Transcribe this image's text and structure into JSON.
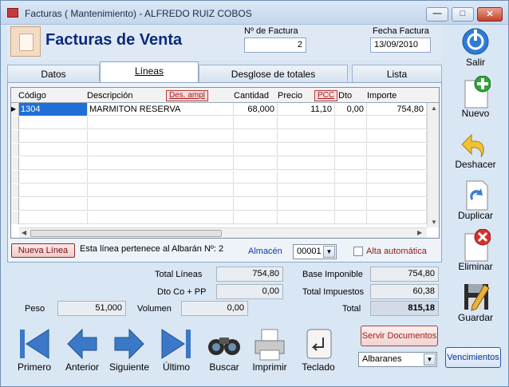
{
  "window": {
    "title": "Facturas ( Mantenimiento) - ALFREDO RUIZ COBOS"
  },
  "header": {
    "title": "Facturas de Venta",
    "invoice_no_label": "Nº de Factura",
    "invoice_no": "2",
    "date_label": "Fecha Factura",
    "date": "13/09/2010"
  },
  "tabs": [
    {
      "label": "Datos"
    },
    {
      "label": "Líneas"
    },
    {
      "label": "Desglose de totales"
    },
    {
      "label": "Lista"
    }
  ],
  "grid": {
    "headers": {
      "codigo": "Código",
      "descripcion": "Descripción",
      "des_ampl": "Des. ampl",
      "cantidad": "Cantidad",
      "precio": "Precio",
      "pcc": "PCC",
      "dto": "Dto",
      "importe": "Importe"
    },
    "rows": [
      {
        "codigo": "1304",
        "descripcion": "MARMITON RESERVA",
        "cantidad": "68,000",
        "precio": "11,10",
        "dto": "0,00",
        "importe": "754,80"
      }
    ]
  },
  "lines": {
    "new_line": "Nueva Línea",
    "albaran_text": "Esta línea pertenece al Albarán Nº: 2",
    "almacen_label": "Almacén",
    "almacen_value": "00001",
    "alta_auto": "Alta automática"
  },
  "totals": {
    "total_lineas_label": "Total Líneas",
    "total_lineas": "754,80",
    "dto_label": "Dto Co + PP",
    "dto": "0,00",
    "peso_label": "Peso",
    "peso": "51,000",
    "volumen_label": "Volumen",
    "volumen": "0,00",
    "base_label": "Base Imponible",
    "base": "754,80",
    "impuestos_label": "Total Impuestos",
    "impuestos": "60,38",
    "total_label": "Total",
    "total": "815,18"
  },
  "side": {
    "salir": "Salir",
    "nuevo": "Nuevo",
    "deshacer": "Deshacer",
    "duplicar": "Duplicar",
    "eliminar": "Eliminar",
    "guardar": "Guardar"
  },
  "bottom": {
    "primero": "Primero",
    "anterior": "Anterior",
    "siguiente": "Siguiente",
    "ultimo": "Último",
    "buscar": "Buscar",
    "imprimir": "Imprimir",
    "teclado": "Teclado"
  },
  "actions": {
    "servir": "Servir Documentos",
    "doc_type": "Albaranes",
    "vencimientos": "Vencimientos"
  },
  "colors": {
    "accent": "#0c2a7a",
    "total_bg": "#d3dbe8"
  }
}
